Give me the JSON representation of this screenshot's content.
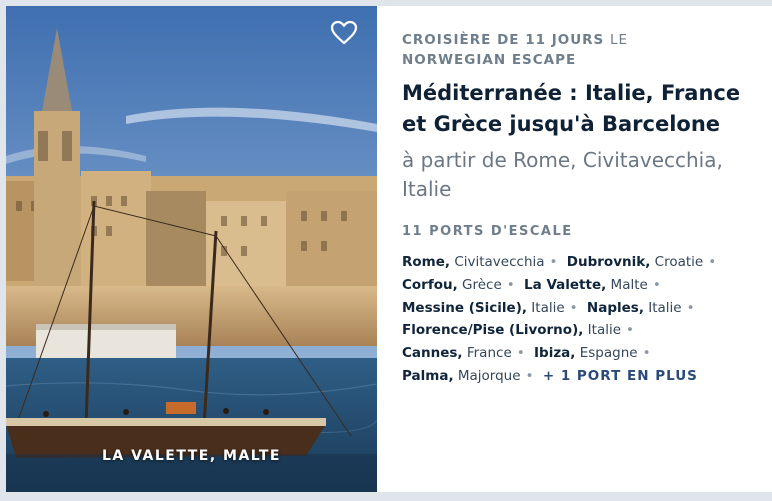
{
  "photo": {
    "caption": "LA VALETTE, MALTE",
    "favorite_icon": "heart-outline-icon"
  },
  "cruise": {
    "duration_label": "CROISIÈRE DE 11 JOURS",
    "ship_prefix": "LE",
    "ship_name": "NORWEGIAN ESCAPE",
    "title": "Méditerranée : Italie, France et Grèce jusqu'à Barcelone",
    "departure": "à partir de Rome, Civitavecchia, Italie"
  },
  "ports": {
    "heading": "11 PORTS D'ESCALE",
    "list": [
      {
        "city": "Rome,",
        "country": "Civitavecchia"
      },
      {
        "city": "Dubrovnik,",
        "country": "Croatie"
      },
      {
        "city": "Corfou,",
        "country": "Grèce"
      },
      {
        "city": "La Valette,",
        "country": "Malte"
      },
      {
        "city": "Messine (Sicile),",
        "country": "Italie"
      },
      {
        "city": "Naples,",
        "country": "Italie"
      },
      {
        "city": "Florence/Pise (Livorno),",
        "country": "Italie"
      },
      {
        "city": "Cannes,",
        "country": "France"
      },
      {
        "city": "Ibiza,",
        "country": "Espagne"
      },
      {
        "city": "Palma,",
        "country": "Majorque"
      }
    ],
    "more_label": "+ 1 PORT EN PLUS"
  },
  "colors": {
    "title": "#0f2134",
    "muted": "#6f7e8c",
    "link": "#2a4a78"
  }
}
